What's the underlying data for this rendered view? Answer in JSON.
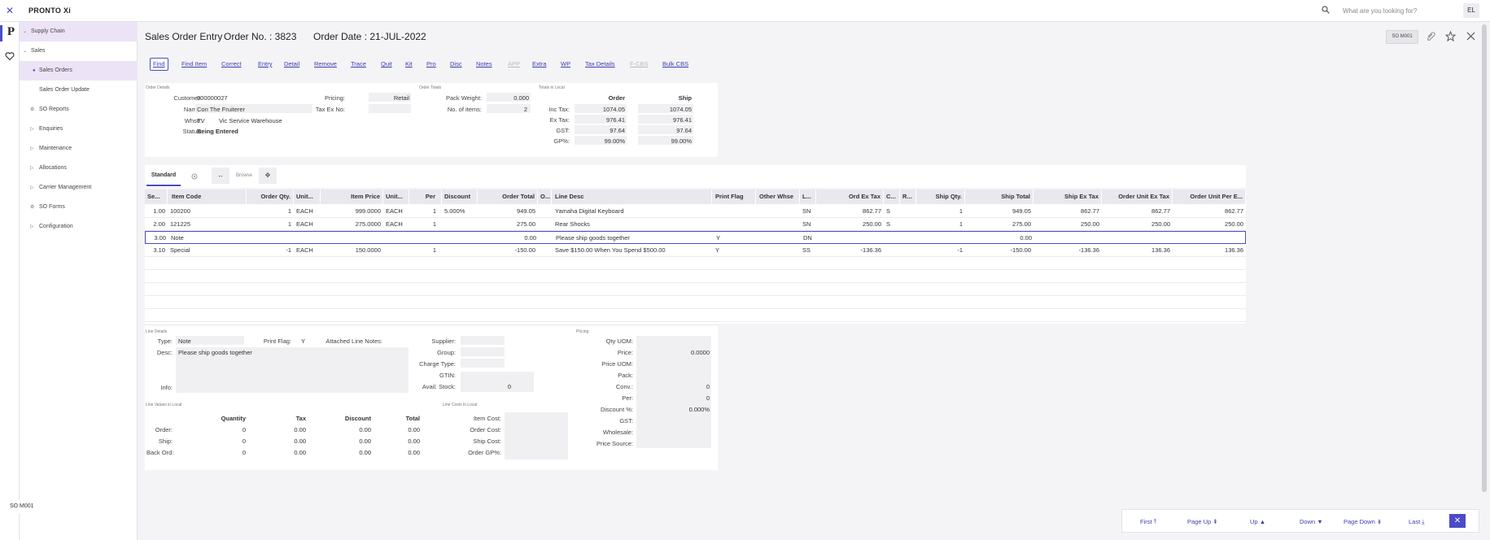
{
  "app": {
    "brand": "PRONTO Xi",
    "search_placeholder": "What are you looking for?",
    "user_initials": "EL"
  },
  "sidebar": {
    "items": [
      {
        "label": "Supply Chain",
        "icon": "chevron-down-icon"
      },
      {
        "label": "Sales",
        "icon": "chevron-down-icon"
      },
      {
        "label": "Sales Orders",
        "icon": "dot-icon"
      },
      {
        "label": "Sales Order Update",
        "icon": ""
      },
      {
        "label": "SO Reports",
        "icon": "settings-icon"
      },
      {
        "label": "Enquiries",
        "icon": "triangle-right-icon"
      },
      {
        "label": "Maintenance",
        "icon": "triangle-right-icon"
      },
      {
        "label": "Allocations",
        "icon": "triangle-right-icon"
      },
      {
        "label": "Carrier Management",
        "icon": "triangle-right-icon"
      },
      {
        "label": "SO Forms",
        "icon": "settings-icon"
      },
      {
        "label": "Configuration",
        "icon": "triangle-right-icon"
      }
    ],
    "footer": "SO M001"
  },
  "header": {
    "title": "Sales Order Entry",
    "order_no": "Order No. : 3823",
    "order_date": "Order Date : 21-JUL-2022",
    "badge": "SO M001"
  },
  "toolbar": [
    "Find",
    "Find Item",
    "Correct",
    "Entry",
    "Detail",
    "Remove",
    "Trace",
    "Quit",
    "Kit",
    "Pro",
    "Disc",
    "Notes",
    "APP",
    "Extra",
    "WP",
    "Tax Details",
    "F-CBS",
    "Bulk CBS"
  ],
  "order_details": {
    "section": "Order Details",
    "customer_label": "Customer:",
    "customer": "000000027",
    "name_label": "Name:",
    "name": "Con The Fruiterer",
    "whse_label": "Whse:",
    "whse_code": "TV",
    "whse_name": "Vic Service Warehouse",
    "status_label": "Status:",
    "status": "Being Entered",
    "pricing_label": "Pricing:",
    "pricing": "Retail",
    "taxex_label": "Tax Ex No:",
    "taxex": ""
  },
  "order_totals": {
    "section": "Order Totals",
    "pack_weight_label": "Pack Weight:",
    "pack_weight": "0.000",
    "num_items_label": "No. of items:",
    "num_items": "2"
  },
  "totals_local": {
    "section": "Totals in Local",
    "col_order": "Order",
    "col_ship": "Ship",
    "rows": [
      {
        "label": "Inc Tax:",
        "order": "1074.05",
        "ship": "1074.05"
      },
      {
        "label": "Ex Tax:",
        "order": "976.41",
        "ship": "976.41"
      },
      {
        "label": "GST:",
        "order": "97.64",
        "ship": "97.64"
      },
      {
        "label": "GP%:",
        "order": "99.00%",
        "ship": "99.00%"
      }
    ]
  },
  "view_tabs": {
    "standard": "Standard",
    "browse": "Browse"
  },
  "grid": {
    "headers": [
      "Se...",
      "Item Code",
      "Order Qty.",
      "Unit...",
      "Item Price",
      "Unit...",
      "Per",
      "Discount",
      "Order Total",
      "O...",
      "Line Desc",
      "Print Flag",
      "Other Whse",
      "L...",
      "Ord Ex Tax",
      "C...",
      "R...",
      "Ship Qty.",
      "Ship Total",
      "Ship Ex Tax",
      "Order Unit Ex Tax",
      "Order Unit Per E..."
    ],
    "rows": [
      [
        "1.00",
        "100200",
        "1",
        "EACH",
        "999.0000",
        "EACH",
        "1",
        "5.000%",
        "949.05",
        "",
        "Yamaha Digital Keyboard",
        "",
        "",
        "SN",
        "862.77",
        "S",
        "",
        "1",
        "949.05",
        "862.77",
        "862.77",
        "862.77"
      ],
      [
        "2.00",
        "121225",
        "1",
        "EACH",
        "275.0000",
        "EACH",
        "1",
        "",
        "275.00",
        "",
        "Rear Shocks",
        "",
        "",
        "SN",
        "250.00",
        "S",
        "",
        "1",
        "275.00",
        "250.00",
        "250.00",
        "250.00"
      ],
      [
        "3.00",
        "Note",
        "",
        "",
        "",
        "",
        "",
        "",
        "0.00",
        "",
        "Please ship goods together",
        "Y",
        "",
        "DN",
        "",
        "",
        "",
        "",
        "0.00",
        "",
        "",
        ""
      ],
      [
        "3.10",
        "Special",
        "-1",
        "EACH",
        "150.0000",
        "",
        "1",
        "",
        "-150.00",
        "",
        "Save $150.00 When You Spend $500.00",
        "Y",
        "",
        "SS",
        "-136.36",
        "",
        "",
        "-1",
        "-150.00",
        "-136.36",
        "136.36",
        "136.36"
      ]
    ]
  },
  "line_details": {
    "section": "Line Details",
    "type_label": "Type:",
    "type": "Note",
    "print_flag_label": "Print Flag:",
    "print_flag": "Y",
    "attached_label": "Attached Line Notes:",
    "desc_label": "Desc:",
    "desc": "Please ship goods together",
    "info_label": "Info:",
    "supplier_label": "Supplier:",
    "group_label": "Group:",
    "charge_type_label": "Charge Type:",
    "gtin_label": "GTIN:",
    "avail_stock_label": "Avail. Stock:",
    "avail_stock": "0"
  },
  "line_values": {
    "section": "Line Values in Local",
    "headers": [
      "Quantity",
      "Tax",
      "Discount",
      "Total"
    ],
    "rows": [
      {
        "label": "Order:",
        "vals": [
          "0",
          "0.00",
          "0.00",
          "0.00"
        ]
      },
      {
        "label": "Ship:",
        "vals": [
          "0",
          "0.00",
          "0.00",
          "0.00"
        ]
      },
      {
        "label": "Back Ord:",
        "vals": [
          "0",
          "0.00",
          "0.00",
          "0.00"
        ]
      }
    ]
  },
  "line_costs": {
    "section": "Line Costs in Local",
    "labels": [
      "Item Cost:",
      "Order Cost:",
      "Ship Cost:",
      "Order GP%:"
    ]
  },
  "pricing": {
    "section": "Pricing",
    "rows": [
      {
        "label": "Qty UOM:",
        "value": ""
      },
      {
        "label": "Price:",
        "value": "0.0000"
      },
      {
        "label": "Price UOM:",
        "value": ""
      },
      {
        "label": "Pack:",
        "value": ""
      },
      {
        "label": "Conv.:",
        "value": "0"
      },
      {
        "label": "Per:",
        "value": "0"
      },
      {
        "label": "Discount %:",
        "value": "0.000%"
      },
      {
        "label": "GST:",
        "value": ""
      },
      {
        "label": "Wholesale:",
        "value": ""
      },
      {
        "label": "Price Source:",
        "value": ""
      }
    ]
  },
  "pager": {
    "first": "First",
    "page_up": "Page Up",
    "up": "Up",
    "down": "Down",
    "page_down": "Page Down",
    "last": "Last"
  }
}
